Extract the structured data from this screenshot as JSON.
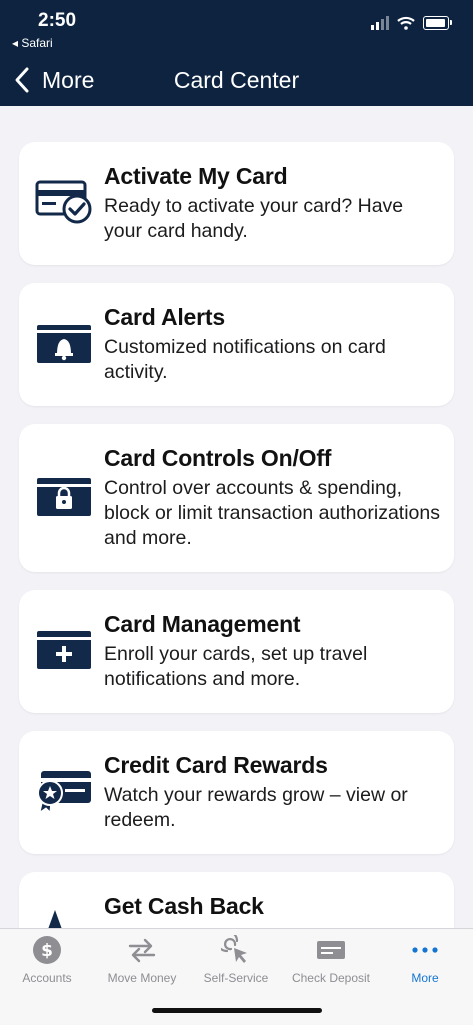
{
  "status": {
    "time": "2:50",
    "back_app": "◂ Safari"
  },
  "nav": {
    "back_label": "More",
    "title": "Card Center"
  },
  "cards": [
    {
      "title": "Activate My Card",
      "desc": "Ready to activate your card? Have your card handy.",
      "icon": "card-check-icon"
    },
    {
      "title": "Card Alerts",
      "desc": "Customized notifications on card activity.",
      "icon": "card-bell-icon"
    },
    {
      "title": "Card Controls On/Off",
      "desc": "Control over accounts & spending, block or limit transaction authorizations and more.",
      "icon": "card-lock-icon"
    },
    {
      "title": "Card Management",
      "desc": "Enroll your cards, set up travel notifications and more.",
      "icon": "card-plus-icon"
    },
    {
      "title": "Credit Card Rewards",
      "desc": "Watch your rewards grow – view or redeem.",
      "icon": "card-award-icon"
    },
    {
      "title": "Get Cash Back",
      "desc": "",
      "icon": "card-cashback-icon"
    }
  ],
  "tabs": [
    {
      "label": "Accounts",
      "icon": "dollar-coin-icon",
      "active": false
    },
    {
      "label": "Move Money",
      "icon": "transfer-arrows-icon",
      "active": false
    },
    {
      "label": "Self-Service",
      "icon": "cursor-click-icon",
      "active": false
    },
    {
      "label": "Check Deposit",
      "icon": "check-icon",
      "active": false
    },
    {
      "label": "More",
      "icon": "more-dots-icon",
      "active": true
    }
  ],
  "colors": {
    "header": "#0d2340",
    "icon": "#12294a",
    "active_tab": "#1476d2",
    "inactive_tab": "#8e8e93",
    "background": "#f2f2f7"
  }
}
